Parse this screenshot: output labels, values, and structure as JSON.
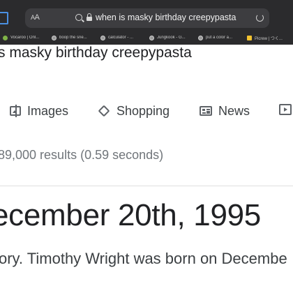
{
  "browser": {
    "text_size_label_small": "A",
    "text_size_label_large": "A",
    "url": "when is masky birthday creepypasta",
    "tabs": [
      {
        "label": "Vocaroo | Onl...",
        "favicon": "vocaroo-icon"
      },
      {
        "label": "boop the sne...",
        "favicon": "globe-icon"
      },
      {
        "label": "calculator - ...",
        "favicon": "globe-icon"
      },
      {
        "label": "Jungkook - G...",
        "favicon": "globe-icon"
      },
      {
        "label": "put a color a...",
        "favicon": "globe-icon"
      },
      {
        "label": "Picrew | つく...",
        "favicon": "picrew-icon"
      }
    ]
  },
  "search": {
    "query": "s masky birthday creepypasta"
  },
  "nav": {
    "items": [
      {
        "label": "Images",
        "icon": "image-icon"
      },
      {
        "label": "Shopping",
        "icon": "tag-icon"
      },
      {
        "label": "News",
        "icon": "news-icon"
      }
    ]
  },
  "results": {
    "stats": "89,000 results (0.59 seconds)",
    "answer": "ecember 20th, 1995",
    "snippet": "ory. Timothy Wright was born on Decembe"
  },
  "colors": {
    "chrome_background": "#2b2b2d",
    "address_bar": "#3d3d40",
    "text_primary": "#202124",
    "text_secondary": "#70757a",
    "accent_blue": "#4a90e2"
  }
}
